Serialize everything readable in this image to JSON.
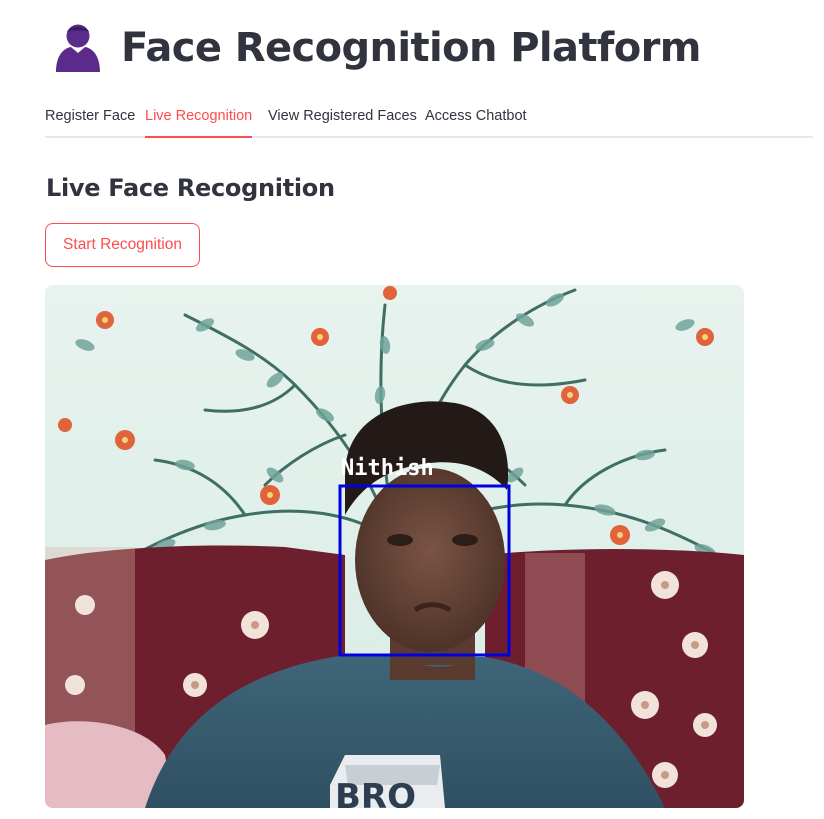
{
  "header": {
    "title": "Face Recognition Platform",
    "icon": "user-silhouette-icon",
    "icon_color": "#5b2b8c"
  },
  "tabs": [
    {
      "label": "Register Face",
      "active": false
    },
    {
      "label": "Live Recognition",
      "active": true
    },
    {
      "label": "View Registered Faces",
      "active": false
    },
    {
      "label": "Access Chatbot",
      "active": false
    }
  ],
  "main": {
    "section_title": "Live Face Recognition",
    "start_button_label": "Start Recognition"
  },
  "camera": {
    "detection_label": "Nithish",
    "box_color": "#0000e0",
    "shirt_print_text": "BRO"
  },
  "colors": {
    "accent": "#ff4b4b",
    "text": "#31333f",
    "divider": "#e6e8ec"
  }
}
